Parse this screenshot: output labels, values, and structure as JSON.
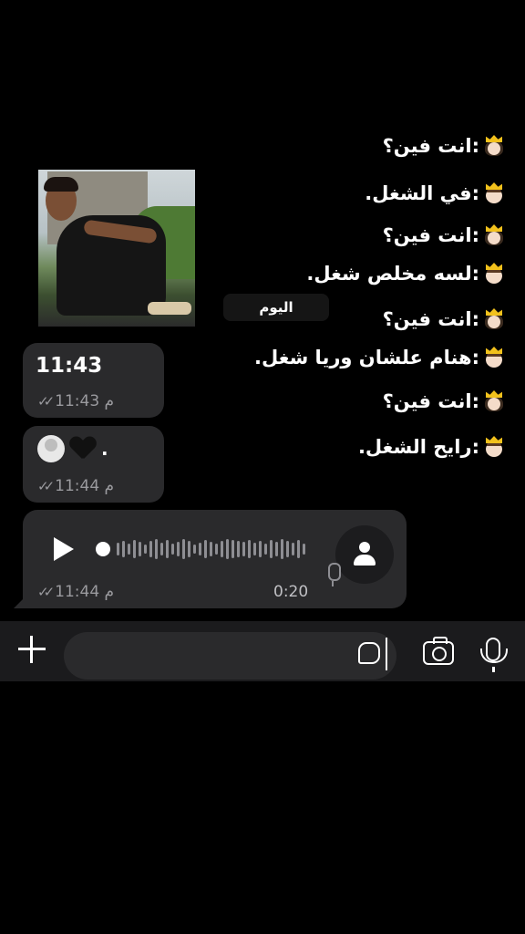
{
  "overlay_lines": [
    {
      "text": ":انت فين؟",
      "speaker": "female-crown-emoji"
    },
    {
      "text": ":في الشغل.",
      "speaker": "male-crown-emoji"
    },
    {
      "text": ":انت فين؟",
      "speaker": "female-crown-emoji"
    },
    {
      "text": ":لسه مخلص شغل.",
      "speaker": "male-crown-emoji"
    },
    {
      "text": ":انت فين؟",
      "speaker": "female-crown-emoji"
    },
    {
      "text": ":هنام علشان وريا شغل.",
      "speaker": "male-crown-emoji"
    },
    {
      "text": ":انت فين؟",
      "speaker": "female-crown-emoji"
    },
    {
      "text": ":رايح الشغل.",
      "speaker": "male-crown-emoji"
    }
  ],
  "date_chip": "اليوم",
  "messages": [
    {
      "text": "11:43",
      "time": "11:43 م"
    },
    {
      "emojis": [
        "avatar-sticker",
        "black-heart"
      ],
      "text": ".",
      "time": "11:44 م"
    }
  ],
  "voice_message": {
    "duration": "0:20",
    "time": "11:44 م"
  },
  "input": {
    "placeholder": "",
    "value": ""
  },
  "colors": {
    "bubble": "#2a2a2c",
    "background": "#000000",
    "meta": "#9a9a9e"
  }
}
